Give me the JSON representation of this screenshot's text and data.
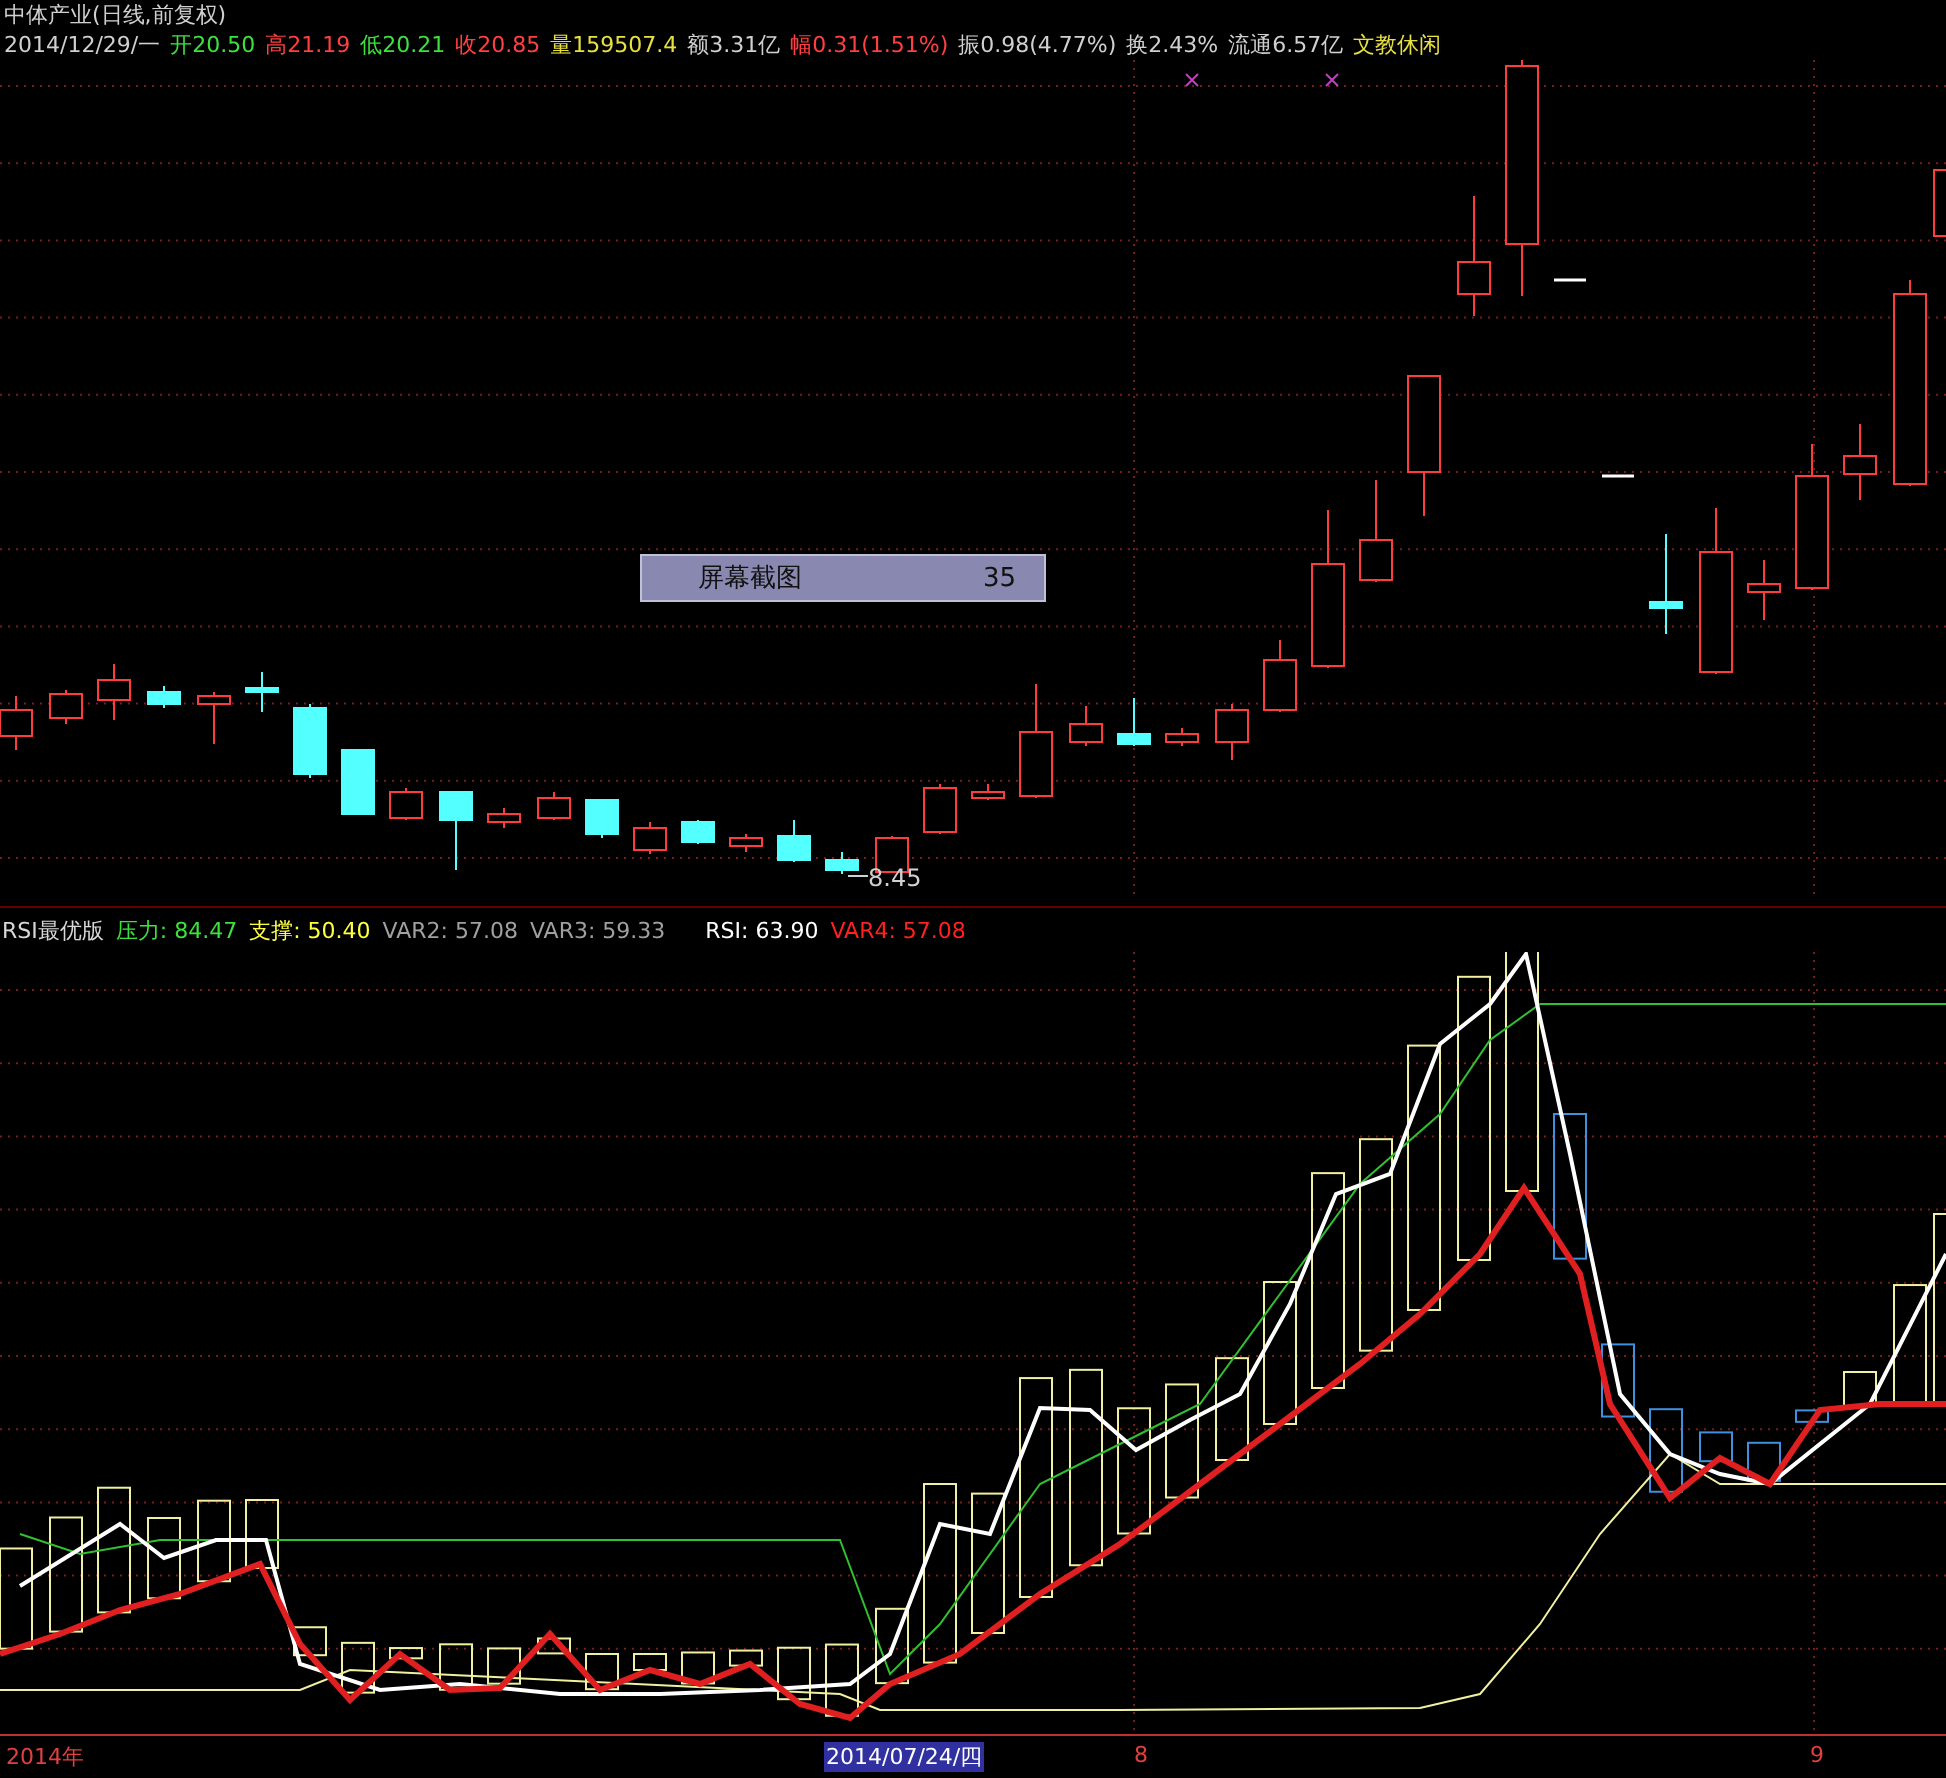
{
  "stock": {
    "title": "中体产业(日线,前复权)",
    "quote": [
      {
        "text": "2014/12/29/一",
        "color": "#d0d0d0"
      },
      {
        "text": "开20.50",
        "color": "#3ee03e"
      },
      {
        "text": "高21.19",
        "color": "#ff4040"
      },
      {
        "text": "低20.21",
        "color": "#3ee03e"
      },
      {
        "text": "收20.85",
        "color": "#ff4040"
      },
      {
        "text": "量159507.4",
        "color": "#e8e040"
      },
      {
        "text": "额3.31亿",
        "color": "#d0d0d0"
      },
      {
        "text": "幅0.31(1.51%)",
        "color": "#ff4040"
      },
      {
        "text": "振0.98(4.77%)",
        "color": "#d0d0d0"
      },
      {
        "text": "换2.43%",
        "color": "#d0d0d0"
      },
      {
        "text": "流通6.57亿",
        "color": "#d0d0d0"
      },
      {
        "text": "文教休闲",
        "color": "#e8e040"
      }
    ]
  },
  "main_chart": {
    "overlay": {
      "label": "屏幕截图",
      "value": "35"
    },
    "low_marker": "8.45"
  },
  "indicator": {
    "name": "RSI最优版",
    "values": [
      {
        "text": "压力: 84.47",
        "color": "#3ee03e"
      },
      {
        "text": "支撑: 50.40",
        "color": "#ffff40"
      },
      {
        "text": "VAR2: 57.08",
        "color": "#a0a0a0"
      },
      {
        "text": "VAR3: 59.33",
        "color": "#a0a0a0"
      },
      {
        "text": "RSI: 63.90",
        "color": "#ffffff"
      },
      {
        "text": "VAR4: 57.08",
        "color": "#ff2020"
      }
    ]
  },
  "axis": [
    {
      "text": "2014年",
      "selected": false
    },
    {
      "text": "2014/07/24/四",
      "selected": true
    },
    {
      "text": "8",
      "selected": false
    },
    {
      "text": "9",
      "selected": false
    }
  ]
}
